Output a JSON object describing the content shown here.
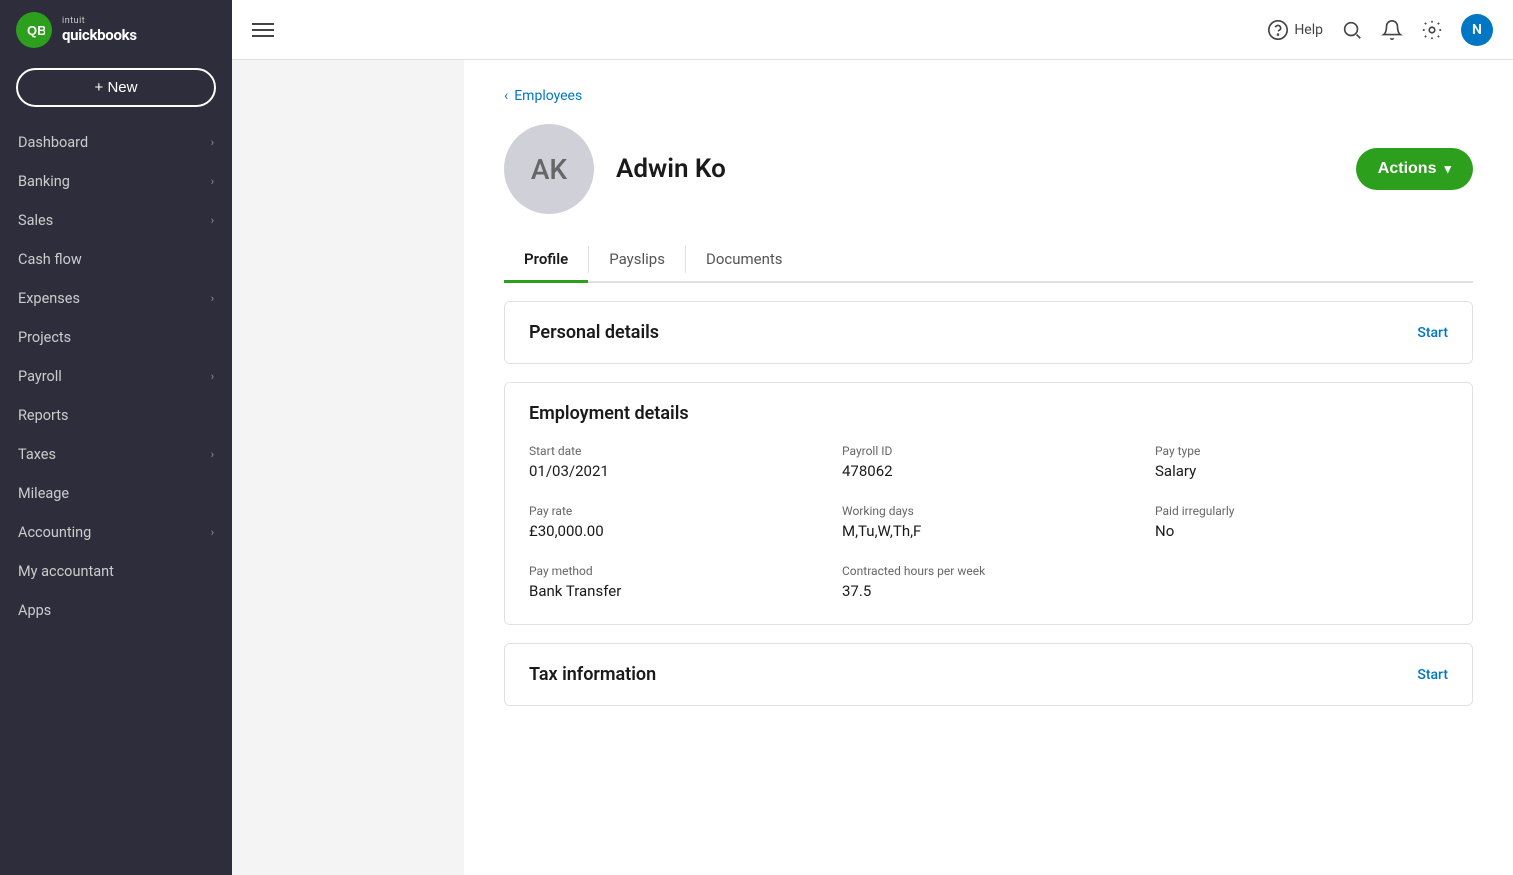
{
  "sidebar": {
    "logo": {
      "intuit": "intuit",
      "quickbooks": "quickbooks"
    },
    "new_button": "+ New",
    "items": [
      {
        "label": "Dashboard",
        "has_chevron": true
      },
      {
        "label": "Banking",
        "has_chevron": true
      },
      {
        "label": "Sales",
        "has_chevron": true
      },
      {
        "label": "Cash flow",
        "has_chevron": false
      },
      {
        "label": "Expenses",
        "has_chevron": true
      },
      {
        "label": "Projects",
        "has_chevron": false
      },
      {
        "label": "Payroll",
        "has_chevron": true
      },
      {
        "label": "Reports",
        "has_chevron": false
      },
      {
        "label": "Taxes",
        "has_chevron": true
      },
      {
        "label": "Mileage",
        "has_chevron": false
      },
      {
        "label": "Accounting",
        "has_chevron": true
      },
      {
        "label": "My accountant",
        "has_chevron": false
      },
      {
        "label": "Apps",
        "has_chevron": false
      }
    ]
  },
  "topbar": {
    "help_label": "Help",
    "user_initial": "N",
    "hamburger_label": "Menu"
  },
  "breadcrumb": {
    "back_label": "Employees"
  },
  "employee": {
    "initials": "AK",
    "name": "Adwin Ko",
    "actions_label": "Actions"
  },
  "tabs": [
    {
      "label": "Profile",
      "active": true
    },
    {
      "label": "Payslips",
      "active": false
    },
    {
      "label": "Documents",
      "active": false
    }
  ],
  "personal_details": {
    "title": "Personal details",
    "action": "Start"
  },
  "employment_details": {
    "title": "Employment details",
    "fields": [
      {
        "label": "Start date",
        "value": "01/03/2021"
      },
      {
        "label": "Payroll ID",
        "value": "478062"
      },
      {
        "label": "Pay type",
        "value": "Salary"
      },
      {
        "label": "Pay rate",
        "value": "£30,000.00"
      },
      {
        "label": "Working days",
        "value": "M,Tu,W,Th,F"
      },
      {
        "label": "Paid irregularly",
        "value": "No"
      },
      {
        "label": "Pay method",
        "value": "Bank Transfer"
      },
      {
        "label": "Contracted hours per week",
        "value": "37.5"
      }
    ]
  },
  "tax_information": {
    "title": "Tax information",
    "action": "Start"
  },
  "colors": {
    "green": "#2ca01c",
    "blue": "#0077c5",
    "sidebar_bg": "#2d2d3b"
  }
}
